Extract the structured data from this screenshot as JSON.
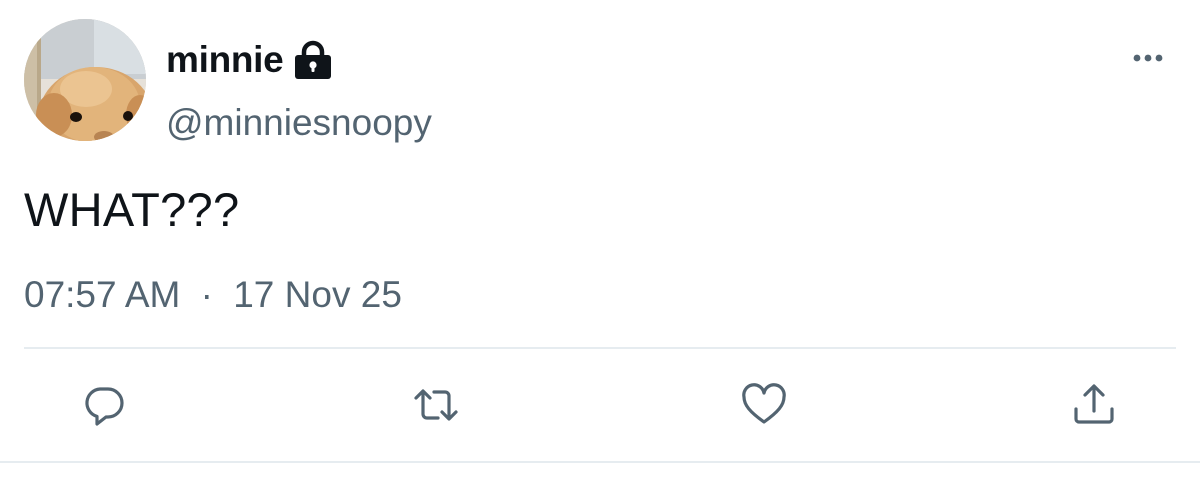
{
  "tweet": {
    "author": {
      "display_name": "minnie",
      "handle": "@minniesnoopy",
      "protected_icon": "lock-icon",
      "avatar": "avatar-image"
    },
    "more_icon": "more-options-icon",
    "text": "WHAT???",
    "time": "07:57 AM",
    "separator": "·",
    "date": "17 Nov 25",
    "actions": [
      {
        "name": "reply",
        "icon": "reply-icon"
      },
      {
        "name": "retweet",
        "icon": "retweet-icon"
      },
      {
        "name": "like",
        "icon": "heart-icon"
      },
      {
        "name": "share",
        "icon": "share-icon"
      }
    ]
  },
  "colors": {
    "primary_text": "#0f1419",
    "secondary_text": "#536471",
    "icon": "#536471",
    "divider": "#e6ecf0"
  }
}
